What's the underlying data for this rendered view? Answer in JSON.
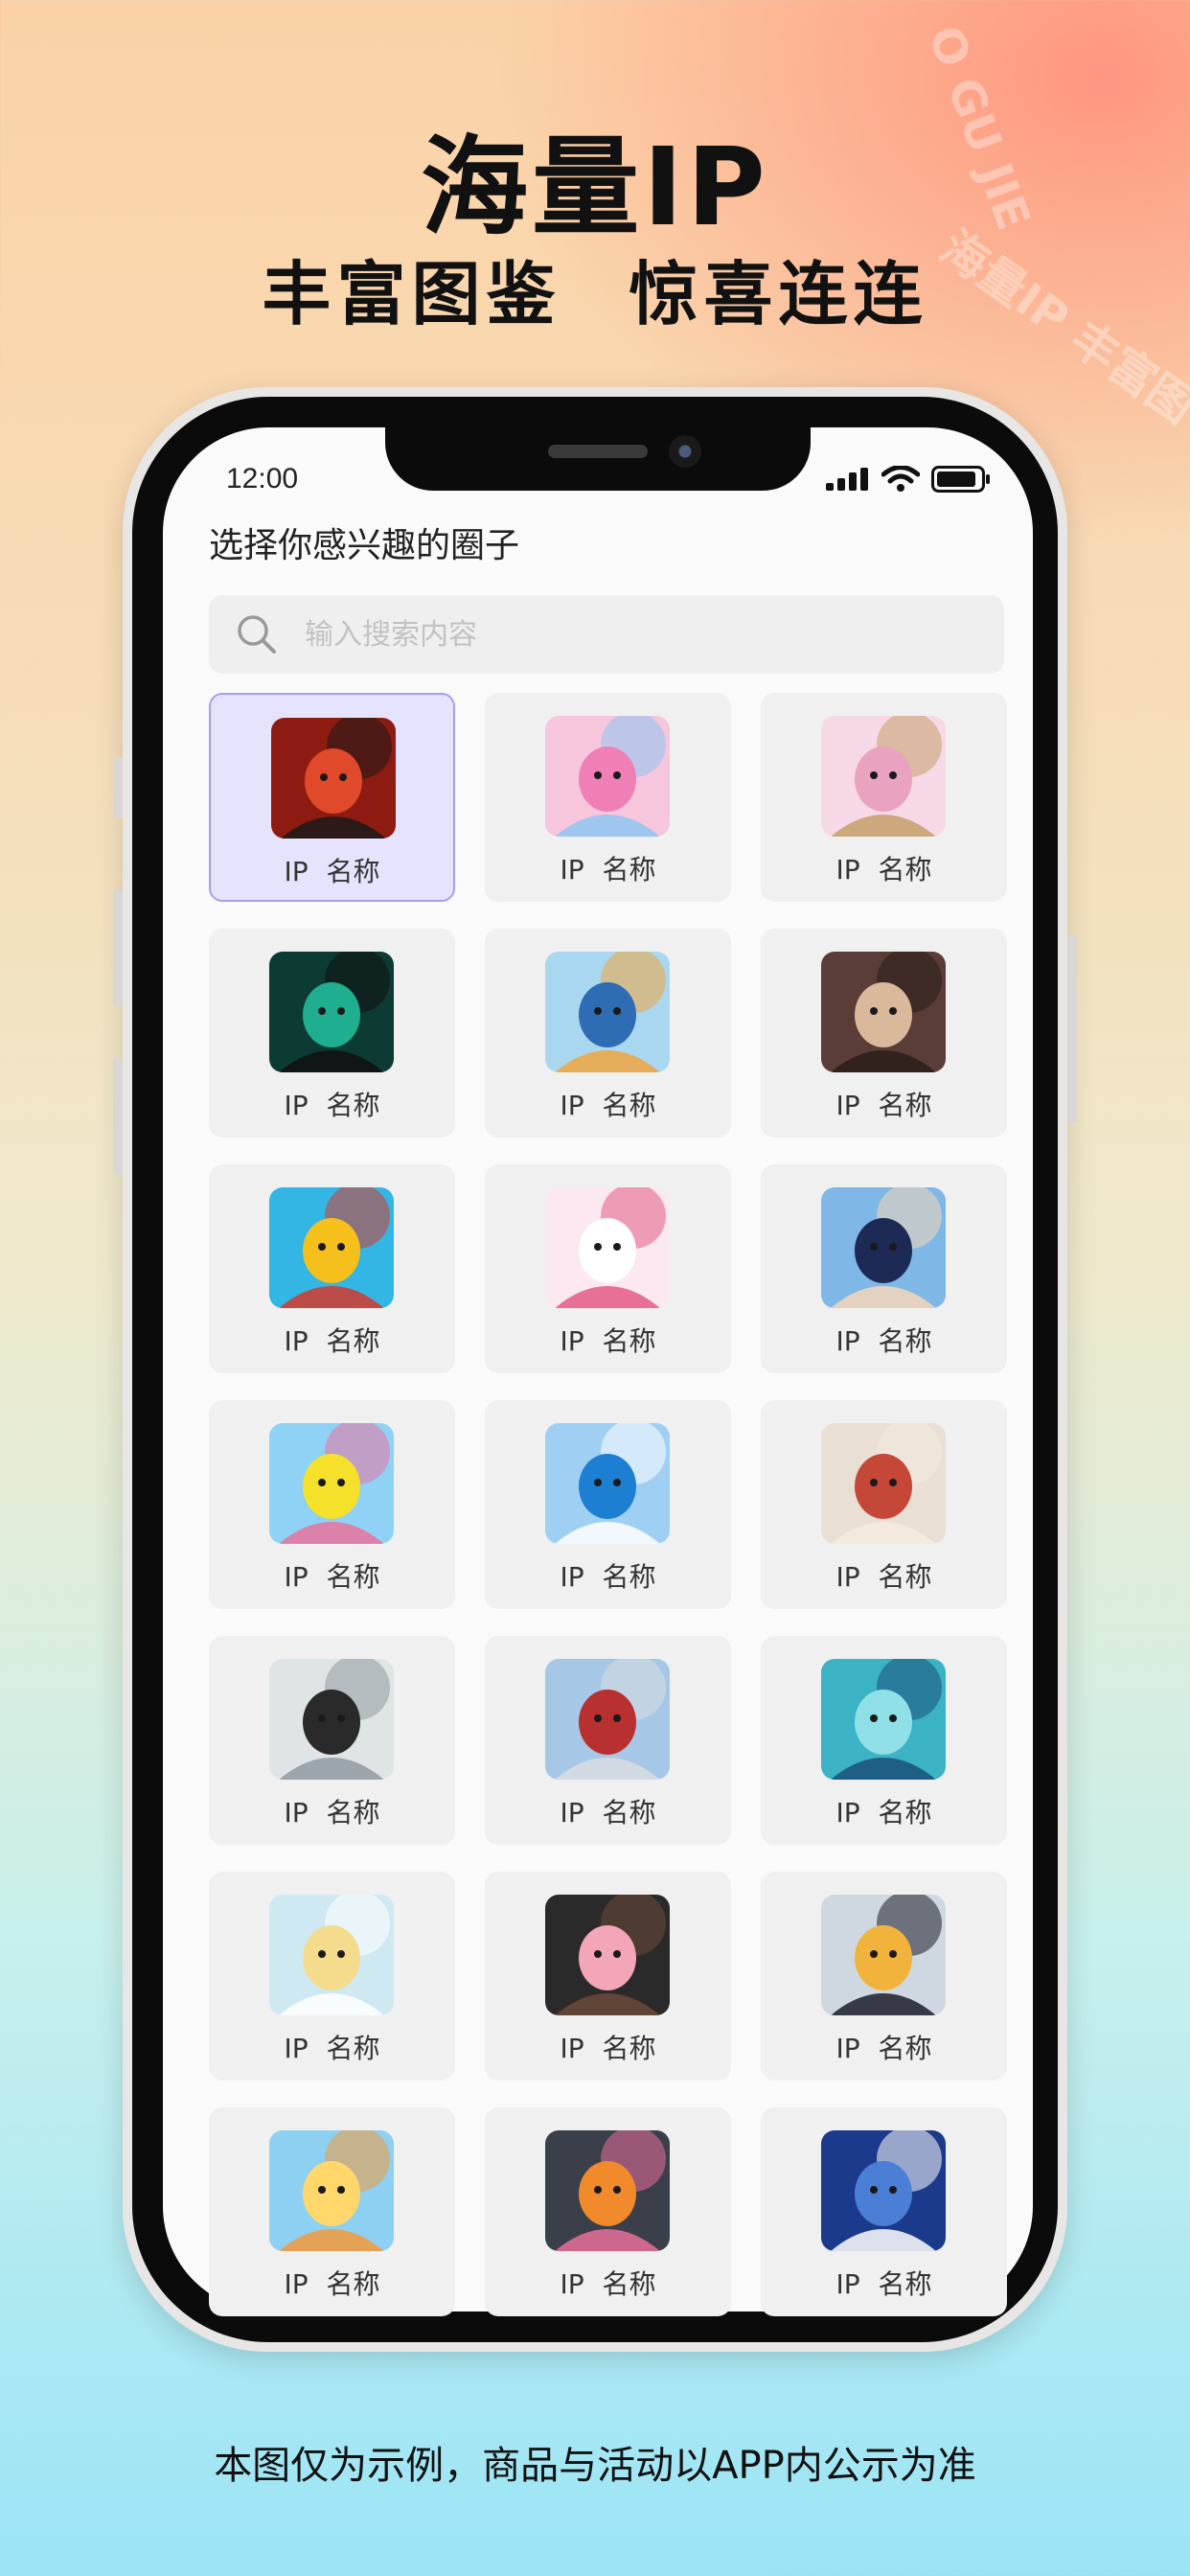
{
  "promo": {
    "title": "海量IP",
    "subtitle": "丰富图鉴  惊喜连连",
    "watermark_a": "O GU JIE",
    "watermark_b": "海量IP  丰富图",
    "footer_note": "本图仅为示例，商品与活动以APP内公示为准"
  },
  "status_bar": {
    "time": "12:00"
  },
  "screen": {
    "title": "选择你感兴趣的圈子",
    "search": {
      "placeholder": "输入搜索内容",
      "value": ""
    }
  },
  "colors": {
    "selected_card_bg": "#e6e3ff",
    "selected_card_border": "#a99df2",
    "card_bg": "#f0f0f0"
  },
  "ip_cards": [
    {
      "label": "IP  名称",
      "selected": true,
      "art": "red-demon-child"
    },
    {
      "label": "IP  名称",
      "selected": false,
      "art": "pink-ponies"
    },
    {
      "label": "IP  名称",
      "selected": false,
      "art": "princess-crown"
    },
    {
      "label": "IP  名称",
      "selected": false,
      "art": "escape-room"
    },
    {
      "label": "IP  名称",
      "selected": false,
      "art": "restaurant-logo"
    },
    {
      "label": "IP  名称",
      "selected": false,
      "art": "gothic-doll"
    },
    {
      "label": "IP  名称",
      "selected": false,
      "art": "cartoon-boy-dog"
    },
    {
      "label": "IP  名称",
      "selected": false,
      "art": "white-kitty"
    },
    {
      "label": "IP  名称",
      "selected": false,
      "art": "detective-boy"
    },
    {
      "label": "IP  名称",
      "selected": false,
      "art": "sea-sponge"
    },
    {
      "label": "IP  名称",
      "selected": false,
      "art": "robot-cat"
    },
    {
      "label": "IP  名称",
      "selected": false,
      "art": "ancient-scholar"
    },
    {
      "label": "IP  名称",
      "selected": false,
      "art": "two-swordsmen"
    },
    {
      "label": "IP  名称",
      "selected": false,
      "art": "silver-hero"
    },
    {
      "label": "IP  名称",
      "selected": false,
      "art": "teal-singer"
    },
    {
      "label": "IP  名称",
      "selected": false,
      "art": "blonde-boy"
    },
    {
      "label": "IP  名称",
      "selected": false,
      "art": "pink-hair-girl"
    },
    {
      "label": "IP  名称",
      "selected": false,
      "art": "duo-heroines"
    },
    {
      "label": "IP  名称",
      "selected": false,
      "art": "egg-mascot"
    },
    {
      "label": "IP  名称",
      "selected": false,
      "art": "ninja-team"
    },
    {
      "label": "IP  名称",
      "selected": false,
      "art": "moon-fisher"
    }
  ]
}
